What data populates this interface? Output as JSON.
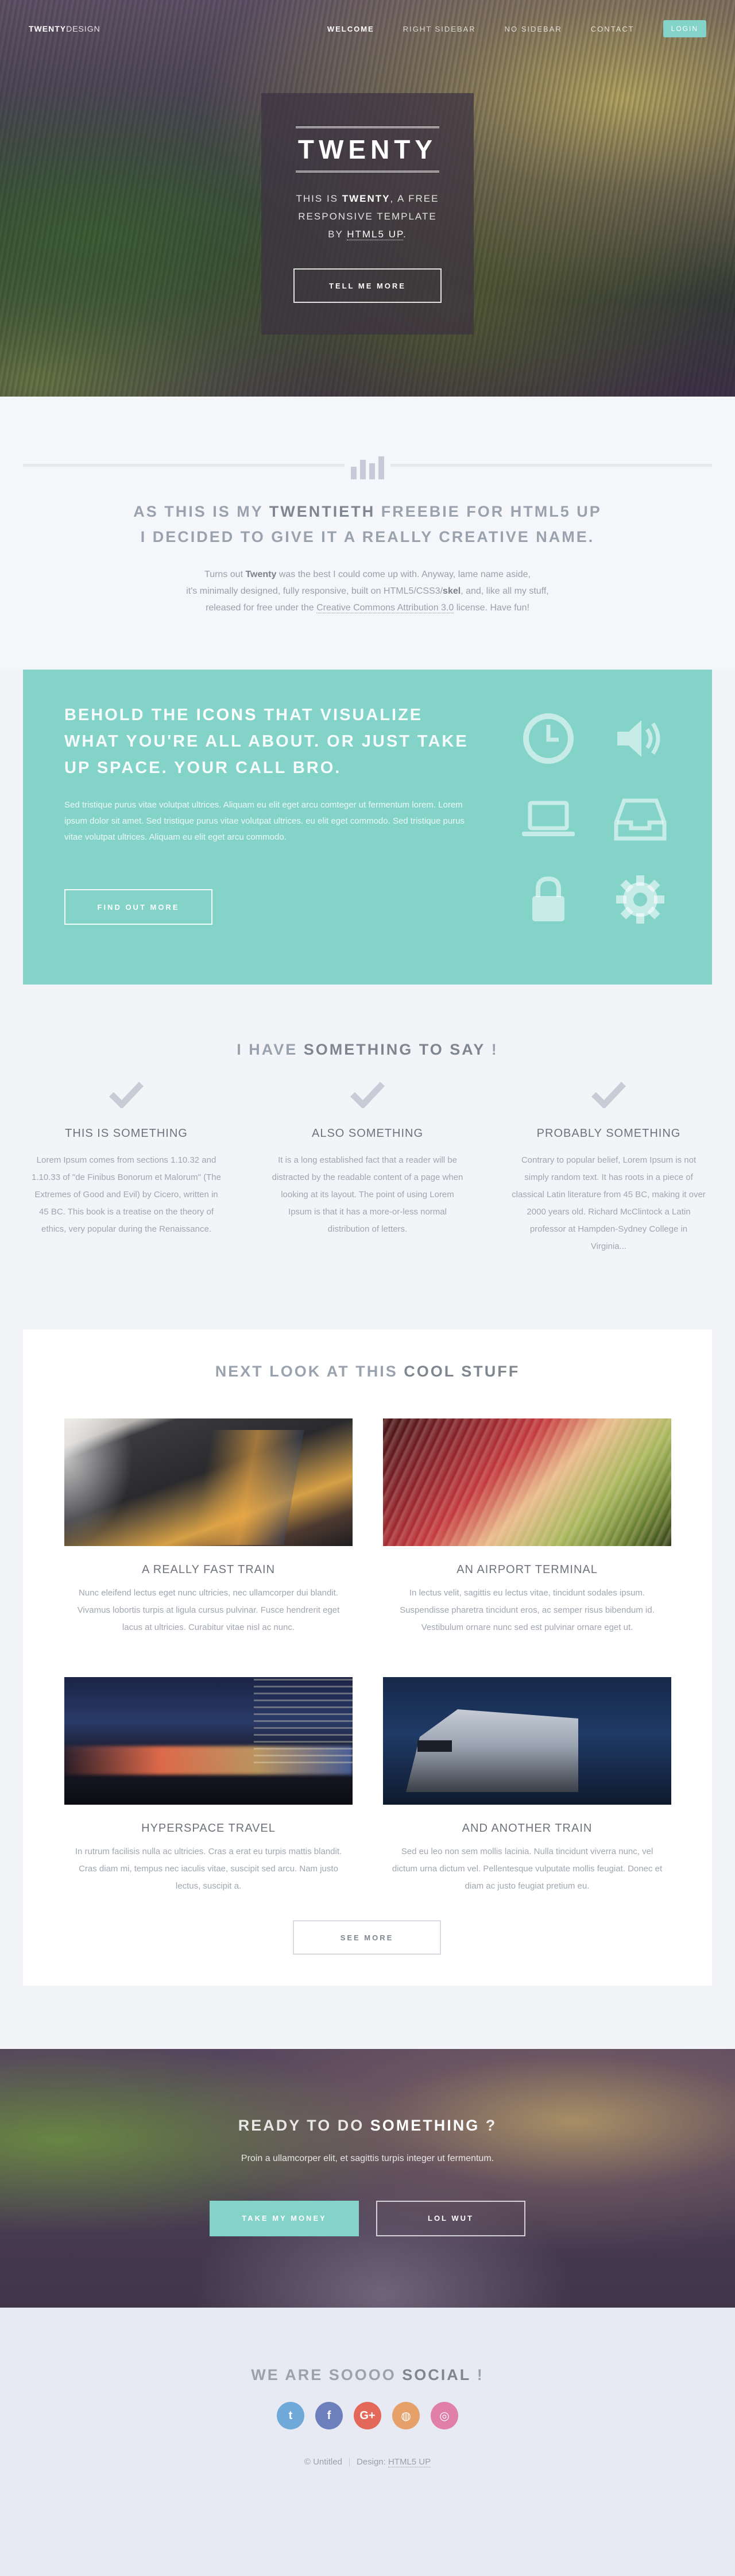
{
  "nav": {
    "logo_bold": "TWENTY",
    "logo_light": "DESIGN",
    "links": [
      "WELCOME",
      "RIGHT SIDEBAR",
      "NO SIDEBAR",
      "CONTACT"
    ],
    "login": "LOGIN"
  },
  "hero": {
    "title": "TWENTY",
    "line1_pre": "THIS IS ",
    "line1_bold": "TWENTY",
    "line1_post": ", A FREE",
    "line2": "RESPONSIVE TEMPLATE",
    "line3_pre": "BY ",
    "line3_link": "HTML5 UP",
    "line3_post": ".",
    "button": "TELL ME MORE"
  },
  "intro": {
    "headline_pre": "AS THIS IS MY ",
    "headline_bold": "TWENTIETH",
    "headline_post": " FREEBIE FOR HTML5 UP",
    "headline_line2": "I DECIDED TO GIVE IT A REALLY CREATIVE NAME.",
    "text_pre": "Turns out ",
    "text_bold": "Twenty",
    "text_mid": " was the best I could come up with. Anyway, lame name aside,",
    "text_line2_pre": "it's minimally designed, fully responsive, built on HTML5/CSS3/",
    "text_line2_bold": "skel",
    "text_line2_post": ", and, like all my stuff,",
    "text_line3_pre": "released for free under the ",
    "text_line3_link": "Creative Commons Attribution 3.0",
    "text_line3_post": " license. Have fun!"
  },
  "feature": {
    "headline_pre": "BEHOLD THE ",
    "headline_bold": "ICONS",
    "headline_post": " THAT VISUALIZE WHAT YOU'RE ALL ABOUT. OR JUST TAKE UP SPACE. YOUR CALL BRO.",
    "text": "Sed tristique purus vitae volutpat ultrices. Aliquam eu elit eget arcu comteger ut fermentum lorem. Lorem ipsum dolor sit amet. Sed tristique purus vitae volutpat ultrices. eu elit eget commodo. Sed tristique purus vitae volutpat ultrices. Aliquam eu elit eget arcu commodo.",
    "button": "FIND OUT MORE",
    "icons": [
      "clock-icon",
      "volume-icon",
      "laptop-icon",
      "inbox-icon",
      "lock-icon",
      "gear-icon"
    ]
  },
  "say": {
    "head_pre": "I HAVE ",
    "head_bold": "SOMETHING TO SAY",
    "head_post": " !",
    "columns": [
      {
        "title": "THIS IS SOMETHING",
        "text": "Lorem Ipsum comes from sections 1.10.32 and 1.10.33 of \"de Finibus Bonorum et Malorum\" (The Extremes of Good and Evil) by Cicero, written in 45 BC. This book is a treatise on the theory of ethics, very popular during the Renaissance."
      },
      {
        "title": "ALSO SOMETHING",
        "text": "It is a long established fact that a reader will be distracted by the readable content of a page when looking at its layout. The point of using Lorem Ipsum is that it has a more-or-less normal distribution of letters."
      },
      {
        "title": "PROBABLY SOMETHING",
        "text": "Contrary to popular belief, Lorem Ipsum is not simply random text. It has roots in a piece of classical Latin literature from 45 BC, making it over 2000 years old. Richard McClintock a Latin professor at Hampden-Sydney College in Virginia..."
      }
    ]
  },
  "cool": {
    "head_pre": "NEXT LOOK AT THIS ",
    "head_bold": "COOL STUFF",
    "cards": [
      {
        "title": "A REALLY FAST TRAIN",
        "text": "Nunc eleifend lectus eget nunc ultricies, nec ullamcorper dui blandit. Vivamus lobortis turpis at ligula cursus pulvinar. Fusce hendrerit eget lacus at ultricies. Curabitur vitae nisl ac nunc."
      },
      {
        "title": "AN AIRPORT TERMINAL",
        "text": "In lectus velit, sagittis eu lectus vitae, tincidunt sodales ipsum. Suspendisse pharetra tincidunt eros, ac semper risus bibendum id. Vestibulum ornare nunc sed est pulvinar ornare eget ut."
      },
      {
        "title": "HYPERSPACE TRAVEL",
        "text": "In rutrum facilisis nulla ac ultricies. Cras a erat eu turpis mattis blandit. Cras diam mi, tempus nec iaculis vitae, suscipit sed arcu. Nam justo lectus, suscipit a."
      },
      {
        "title": "AND ANOTHER TRAIN",
        "text": "Sed eu leo non sem mollis lacinia. Nulla tincidunt viverra nunc, vel dictum urna dictum vel. Pellentesque vulputate mollis feugiat. Donec et diam ac justo feugiat pretium eu."
      }
    ],
    "button": "SEE MORE"
  },
  "cta": {
    "head_pre": "READY TO DO ",
    "head_bold": "SOMETHING",
    "head_post": " ?",
    "text": "Proin a ullamcorper elit, et sagittis turpis integer ut fermentum.",
    "button1": "TAKE MY MONEY",
    "button2": "LOL WUT"
  },
  "footer": {
    "head_pre": "WE ARE SOOOO ",
    "head_bold": "SOCIAL",
    "head_post": " !",
    "socials": [
      {
        "name": "twitter-icon",
        "glyph": "t",
        "color": "#6fa9d9"
      },
      {
        "name": "facebook-icon",
        "glyph": "f",
        "color": "#6d7fbd"
      },
      {
        "name": "google-plus-icon",
        "glyph": "G+",
        "color": "#e4685a"
      },
      {
        "name": "github-icon",
        "glyph": "◍",
        "color": "#e6a06a"
      },
      {
        "name": "dribbble-icon",
        "glyph": "◎",
        "color": "#e07fa8"
      }
    ],
    "copyright": "© Untitled",
    "design_label": "Design: ",
    "design_link": "HTML5 UP"
  },
  "colors": {
    "accent": "#83d3c9",
    "text": "#8a8e96",
    "heading": "#7f868f"
  }
}
